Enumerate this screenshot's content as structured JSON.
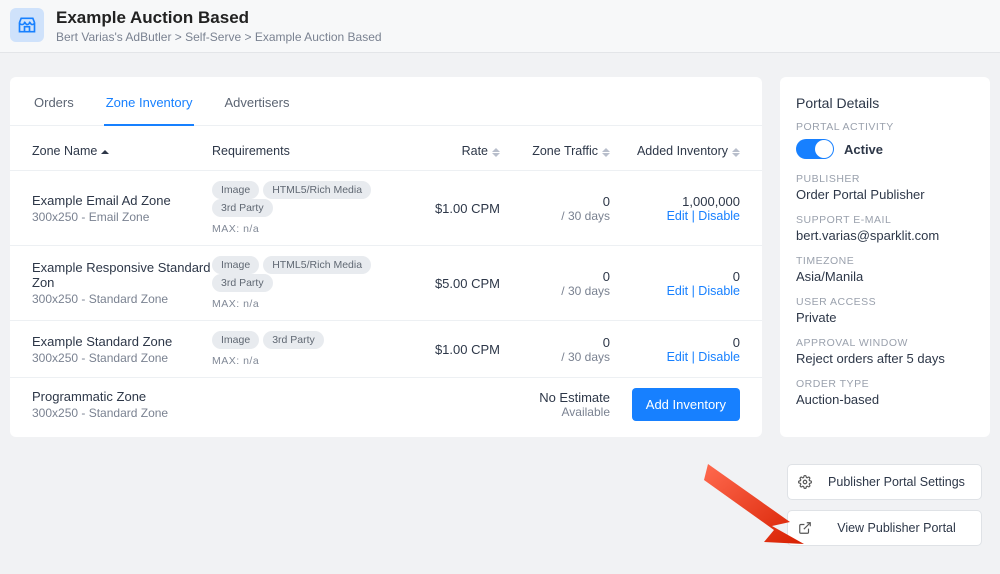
{
  "header": {
    "title": "Example Auction Based",
    "breadcrumb": "Bert Varias's AdButler  >  Self-Serve  >  Example Auction Based"
  },
  "tabs": {
    "orders": "Orders",
    "zone": "Zone Inventory",
    "advertisers": "Advertisers"
  },
  "columns": {
    "name": "Zone Name",
    "req": "Requirements",
    "rate": "Rate",
    "traffic": "Zone Traffic",
    "inv": "Added Inventory"
  },
  "zones": [
    {
      "name": "Example Email Ad Zone",
      "sub": "300x250 - Email Zone",
      "tags": [
        "Image",
        "HTML5/Rich Media",
        "3rd Party"
      ],
      "max": "MAX: n/a",
      "rate": "$1.00 CPM",
      "traffic_top": "0",
      "traffic_sub": "/ 30 days",
      "inv_top": "1,000,000",
      "inv_sub": "Edit | Disable",
      "has_links": true
    },
    {
      "name": "Example Responsive Standard Zon",
      "sub": "300x250 - Standard Zone",
      "tags": [
        "Image",
        "HTML5/Rich Media",
        "3rd Party"
      ],
      "max": "MAX: n/a",
      "rate": "$5.00 CPM",
      "traffic_top": "0",
      "traffic_sub": "/ 30 days",
      "inv_top": "0",
      "inv_sub": "Edit | Disable",
      "has_links": true
    },
    {
      "name": "Example Standard Zone",
      "sub": "300x250 - Standard Zone",
      "tags": [
        "Image",
        "3rd Party"
      ],
      "max": "MAX: n/a",
      "rate": "$1.00 CPM",
      "traffic_top": "0",
      "traffic_sub": "/ 30 days",
      "inv_top": "0",
      "inv_sub": "Edit | Disable",
      "has_links": true
    },
    {
      "name": "Programmatic Zone",
      "sub": "300x250 - Standard Zone",
      "tags": [],
      "max": "",
      "rate": "",
      "traffic_top": "No Estimate",
      "traffic_sub": "Available",
      "inv_top": "",
      "inv_sub": "",
      "has_links": false,
      "add_btn": "Add Inventory"
    }
  ],
  "sidebar": {
    "heading": "Portal Details",
    "activity_label": "PORTAL ACTIVITY",
    "active": "Active",
    "publisher_label": "PUBLISHER",
    "publisher": "Order Portal Publisher",
    "support_label": "SUPPORT E-MAIL",
    "support": "bert.varias@sparklit.com",
    "tz_label": "TIMEZONE",
    "tz": "Asia/Manila",
    "access_label": "USER ACCESS",
    "access": "Private",
    "approval_label": "APPROVAL WINDOW",
    "approval": "Reject orders after 5 days",
    "order_type_label": "ORDER TYPE",
    "order_type": "Auction-based"
  },
  "actions": {
    "settings": "Publisher Portal Settings",
    "view": "View Publisher Portal"
  }
}
